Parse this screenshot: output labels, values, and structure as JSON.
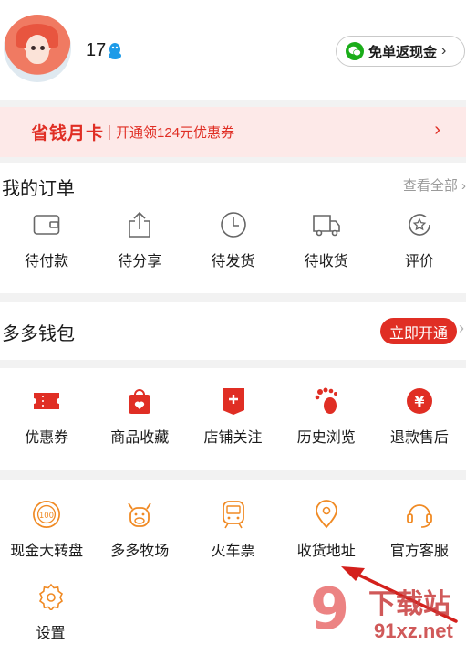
{
  "profile": {
    "username": "17"
  },
  "cashback_button": {
    "label": "免单返现金",
    "chevron": "›"
  },
  "banner": {
    "title": "省钱月卡",
    "subtitle": "开通领124元优惠券",
    "chevron": "›"
  },
  "orders": {
    "title": "我的订单",
    "see_all": "查看全部 ›",
    "items": [
      {
        "label": "待付款",
        "icon": "wallet-icon"
      },
      {
        "label": "待分享",
        "icon": "share-icon"
      },
      {
        "label": "待发货",
        "icon": "clock-icon"
      },
      {
        "label": "待收货",
        "icon": "truck-icon"
      },
      {
        "label": "评价",
        "icon": "review-icon"
      }
    ]
  },
  "wallet": {
    "title": "多多钱包",
    "open_label": "立即开通",
    "chevron": "›"
  },
  "services": {
    "items": [
      {
        "label": "优惠券",
        "icon": "coupon-icon"
      },
      {
        "label": "商品收藏",
        "icon": "favorite-bag-icon"
      },
      {
        "label": "店铺关注",
        "icon": "store-follow-icon"
      },
      {
        "label": "历史浏览",
        "icon": "footprint-icon"
      },
      {
        "label": "退款售后",
        "icon": "refund-icon"
      }
    ]
  },
  "tools": {
    "items": [
      {
        "label": "现金大转盘",
        "icon": "wheel-icon"
      },
      {
        "label": "多多牧场",
        "icon": "cow-icon"
      },
      {
        "label": "火车票",
        "icon": "train-icon"
      },
      {
        "label": "收货地址",
        "icon": "location-icon"
      },
      {
        "label": "官方客服",
        "icon": "headset-icon"
      },
      {
        "label": "设置",
        "icon": "settings-icon"
      }
    ]
  },
  "watermark": {
    "brand": "下载站",
    "url": "91xz.net",
    "logo": "9"
  },
  "colors": {
    "accent": "#e02e24",
    "orange": "#f08a24",
    "banner_bg": "#fde9e8"
  }
}
